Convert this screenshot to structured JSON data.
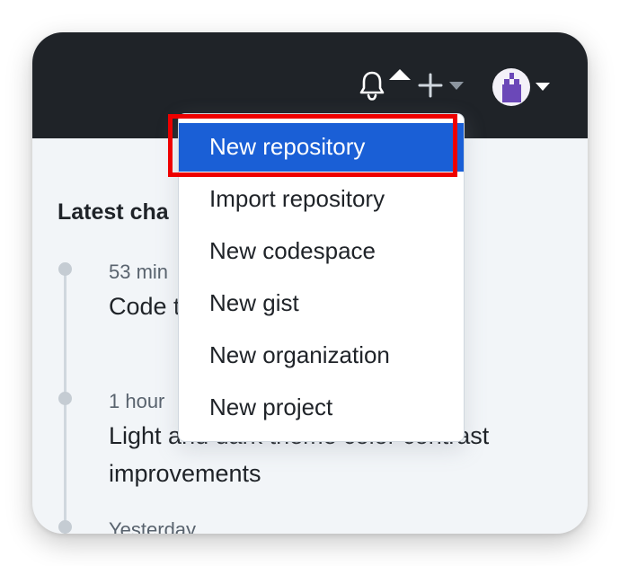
{
  "header": {
    "bell_icon": "bell-icon",
    "create_icon": "plus-icon",
    "caret_icon": "chevron-down-icon",
    "avatar_icon": "avatar"
  },
  "feed": {
    "heading": "Latest cha",
    "items": [
      {
        "time": "53 min",
        "title": "Code                                   th of tools e"
      },
      {
        "time": "1 hour",
        "title": "Light and dark theme color contrast improvements"
      },
      {
        "time": "Yesterday",
        "title": ""
      }
    ]
  },
  "create_menu": {
    "items": [
      {
        "label": "New repository",
        "active": true
      },
      {
        "label": "Import repository"
      },
      {
        "label": "New codespace"
      },
      {
        "label": "New gist"
      },
      {
        "label": "New organization"
      },
      {
        "label": "New project"
      }
    ]
  },
  "colors": {
    "header_bg": "#1f2328",
    "page_bg": "#f2f5f8",
    "active_item": "#1a5fd6",
    "highlight": "#ee0000"
  }
}
